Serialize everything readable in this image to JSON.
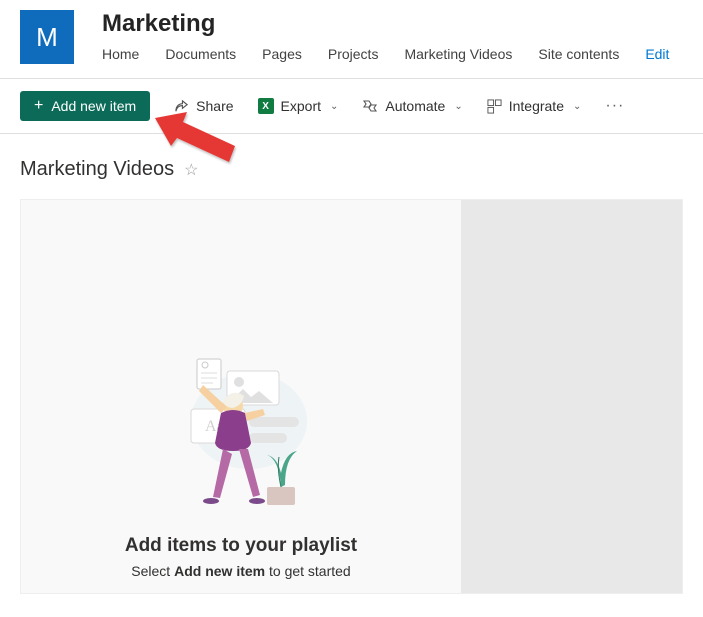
{
  "site": {
    "logoLetter": "M",
    "title": "Marketing"
  },
  "nav": {
    "items": [
      "Home",
      "Documents",
      "Pages",
      "Projects",
      "Marketing Videos",
      "Site contents"
    ],
    "editLabel": "Edit"
  },
  "commandBar": {
    "addNew": "Add new item",
    "share": "Share",
    "export": "Export",
    "automate": "Automate",
    "integrate": "Integrate"
  },
  "page": {
    "title": "Marketing Videos"
  },
  "emptyState": {
    "heading": "Add items to your playlist",
    "subtextPrefix": "Select ",
    "subtextBold": "Add new item",
    "subtextSuffix": " to get started"
  }
}
